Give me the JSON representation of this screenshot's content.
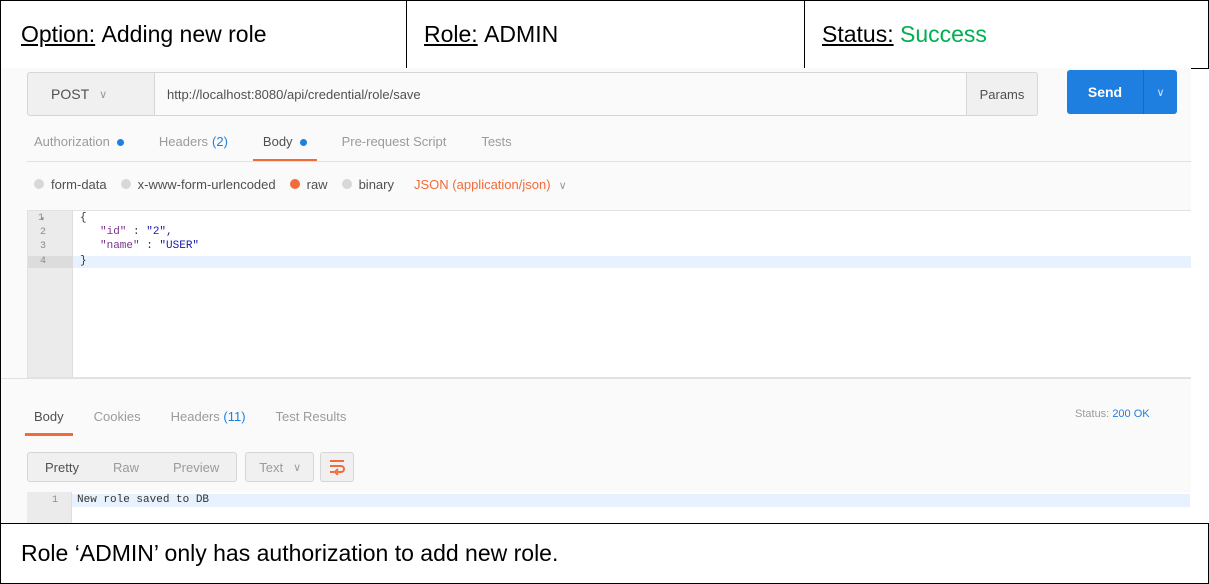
{
  "header": {
    "option_label": "Option:",
    "option_value": "Adding new role",
    "role_label": "Role:",
    "role_value": "ADMIN",
    "status_label": "Status:",
    "status_value": "Success"
  },
  "request": {
    "method": "POST",
    "url": "http://localhost:8080/api/credential/role/save",
    "params_label": "Params",
    "send_label": "Send"
  },
  "request_tabs": [
    {
      "label": "Authorization",
      "count": ""
    },
    {
      "label": "Headers",
      "count": "(2)"
    },
    {
      "label": "Body",
      "count": ""
    },
    {
      "label": "Pre-request Script",
      "count": ""
    },
    {
      "label": "Tests",
      "count": ""
    }
  ],
  "body_options": {
    "form_data": "form-data",
    "urlencoded": "x-www-form-urlencoded",
    "raw": "raw",
    "binary": "binary",
    "content_type": "JSON (application/json)"
  },
  "request_body": {
    "line_numbers": [
      "1",
      "2",
      "3",
      "4"
    ],
    "lines": [
      "{",
      "\"id\"",
      " : ",
      "\"2\",",
      "\"name\"",
      " : ",
      "\"USER\"",
      "}"
    ]
  },
  "response_tabs": [
    {
      "label": "Body",
      "count": ""
    },
    {
      "label": "Cookies",
      "count": ""
    },
    {
      "label": "Headers",
      "count": "(11)"
    },
    {
      "label": "Test Results",
      "count": ""
    }
  ],
  "response_status": {
    "label": "Status:",
    "value": "200 OK"
  },
  "view_modes": [
    "Pretty",
    "Raw",
    "Preview"
  ],
  "format_select": "Text",
  "response_body": {
    "line_number": "1",
    "text": "New role saved to DB"
  },
  "footer": {
    "note": "Role ‘ADMIN’ only has authorization to add new role."
  },
  "colors": {
    "accent_orange": "#f26b3a",
    "send_blue": "#1f7fe0",
    "success_green": "#00b050"
  },
  "icons": {
    "method_dropdown": "chevron-down-icon",
    "send_dropdown": "chevron-down-icon",
    "wrap": "wrap-lines-icon"
  }
}
